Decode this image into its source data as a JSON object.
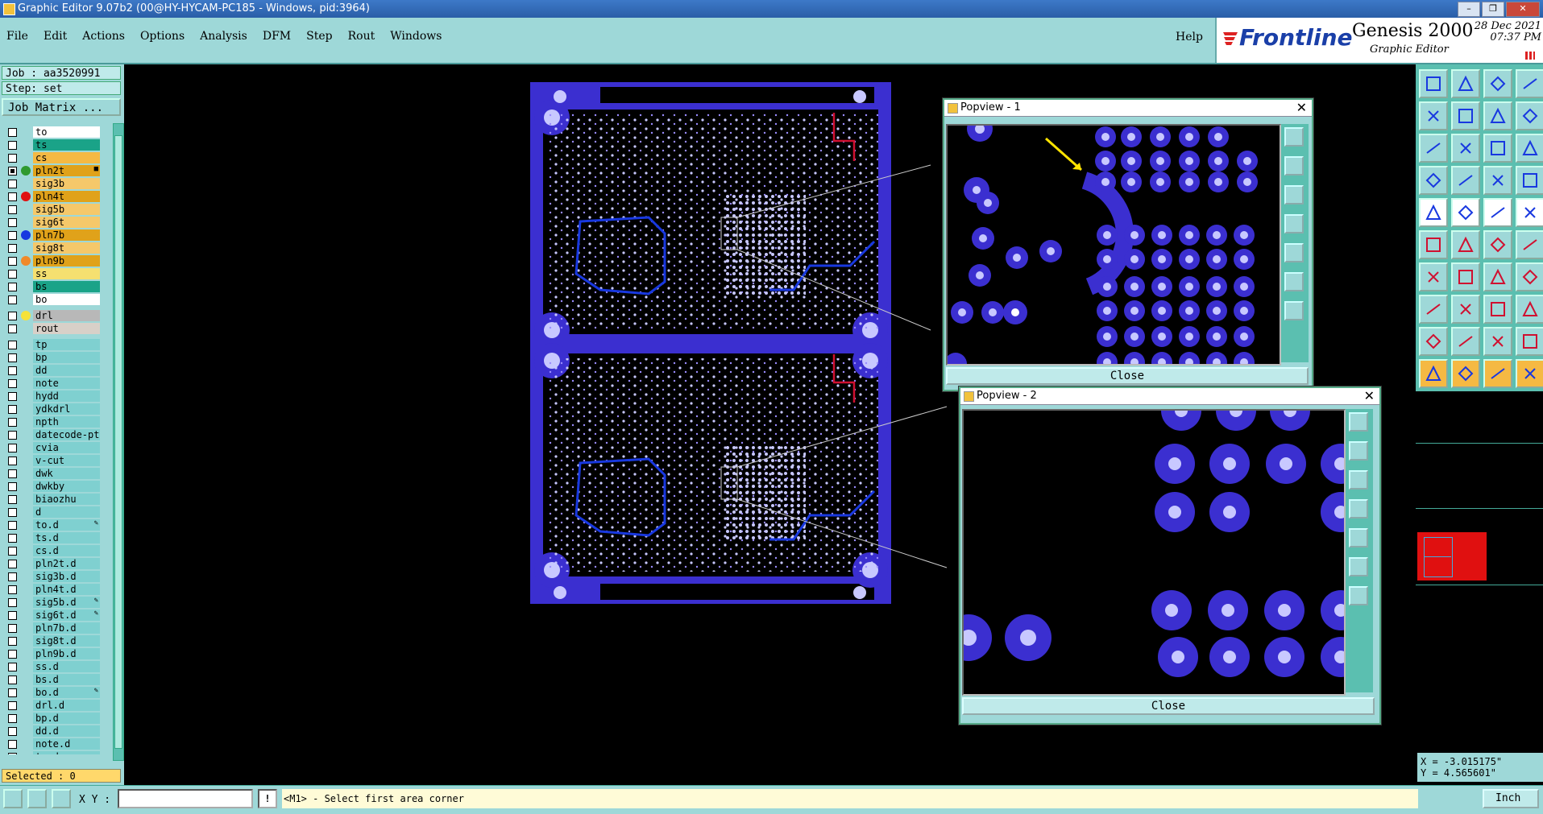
{
  "window": {
    "title": "Graphic Editor 9.07b2 (00@HY-HYCAM-PC185 - Windows, pid:3964)"
  },
  "menu": {
    "items": [
      "File",
      "Edit",
      "Actions",
      "Options",
      "Analysis",
      "DFM",
      "Step",
      "Rout",
      "Windows"
    ],
    "help": "Help"
  },
  "brand": {
    "logo": "Frontline",
    "product": "Genesis 2000",
    "subtitle": "Graphic Editor",
    "date": "28 Dec 2021",
    "time": "07:37 PM"
  },
  "job": {
    "job_label": "Job : aa3520991",
    "step_label": "Step: set",
    "matrix_button": "Job Matrix ..."
  },
  "layers": [
    {
      "name": "to",
      "bg": "#ffffff",
      "dot": "",
      "on": false,
      "sym": ""
    },
    {
      "name": "ts",
      "bg": "#1aa388",
      "dot": "",
      "on": false,
      "sym": ""
    },
    {
      "name": "cs",
      "bg": "#f5b943",
      "dot": "",
      "on": false,
      "sym": ""
    },
    {
      "name": "pln2t",
      "bg": "#e0a21a",
      "dot": "#2f9a2f",
      "on": true,
      "sym": "■"
    },
    {
      "name": "sig3b",
      "bg": "#f5c86a",
      "dot": "",
      "on": false,
      "sym": ""
    },
    {
      "name": "pln4t",
      "bg": "#e0a21a",
      "dot": "#e01010",
      "on": false,
      "sym": ""
    },
    {
      "name": "sig5b",
      "bg": "#f5c86a",
      "dot": "",
      "on": false,
      "sym": ""
    },
    {
      "name": "sig6t",
      "bg": "#f5c86a",
      "dot": "",
      "on": false,
      "sym": ""
    },
    {
      "name": "pln7b",
      "bg": "#e0a21a",
      "dot": "#1838e0",
      "on": false,
      "sym": ""
    },
    {
      "name": "sig8t",
      "bg": "#f5c86a",
      "dot": "",
      "on": false,
      "sym": ""
    },
    {
      "name": "pln9b",
      "bg": "#e0a21a",
      "dot": "#f08a2a",
      "on": false,
      "sym": ""
    },
    {
      "name": "ss",
      "bg": "#f5e070",
      "dot": "",
      "on": false,
      "sym": ""
    },
    {
      "name": "bs",
      "bg": "#1aa388",
      "dot": "",
      "on": false,
      "sym": ""
    },
    {
      "name": "bo",
      "bg": "#ffffff",
      "dot": "",
      "on": false,
      "sym": ""
    },
    {
      "name": "drl",
      "bg": "#b8b8b8",
      "dot": "#f5e23a",
      "on": false,
      "sym": ""
    },
    {
      "name": "rout",
      "bg": "#d8d0c8",
      "dot": "",
      "on": false,
      "sym": ""
    },
    {
      "name": "tp",
      "bg": "#7fd0d0",
      "dot": "",
      "on": false,
      "sym": ""
    },
    {
      "name": "bp",
      "bg": "#7fd0d0",
      "dot": "",
      "on": false,
      "sym": ""
    },
    {
      "name": "dd",
      "bg": "#7fd0d0",
      "dot": "",
      "on": false,
      "sym": ""
    },
    {
      "name": "note",
      "bg": "#7fd0d0",
      "dot": "",
      "on": false,
      "sym": ""
    },
    {
      "name": "hydd",
      "bg": "#7fd0d0",
      "dot": "",
      "on": false,
      "sym": ""
    },
    {
      "name": "ydkdrl",
      "bg": "#7fd0d0",
      "dot": "",
      "on": false,
      "sym": ""
    },
    {
      "name": "npth",
      "bg": "#7fd0d0",
      "dot": "",
      "on": false,
      "sym": ""
    },
    {
      "name": "datecode-pt",
      "bg": "#7fd0d0",
      "dot": "",
      "on": false,
      "sym": ""
    },
    {
      "name": "cvia",
      "bg": "#7fd0d0",
      "dot": "",
      "on": false,
      "sym": ""
    },
    {
      "name": "v-cut",
      "bg": "#7fd0d0",
      "dot": "",
      "on": false,
      "sym": ""
    },
    {
      "name": "dwk",
      "bg": "#7fd0d0",
      "dot": "",
      "on": false,
      "sym": ""
    },
    {
      "name": "dwkby",
      "bg": "#7fd0d0",
      "dot": "",
      "on": false,
      "sym": ""
    },
    {
      "name": "biaozhu",
      "bg": "#7fd0d0",
      "dot": "",
      "on": false,
      "sym": ""
    },
    {
      "name": "d",
      "bg": "#7fd0d0",
      "dot": "",
      "on": false,
      "sym": ""
    },
    {
      "name": "to.d",
      "bg": "#7fd0d0",
      "dot": "",
      "on": false,
      "sym": "✎"
    },
    {
      "name": "ts.d",
      "bg": "#7fd0d0",
      "dot": "",
      "on": false,
      "sym": ""
    },
    {
      "name": "cs.d",
      "bg": "#7fd0d0",
      "dot": "",
      "on": false,
      "sym": ""
    },
    {
      "name": "pln2t.d",
      "bg": "#7fd0d0",
      "dot": "",
      "on": false,
      "sym": ""
    },
    {
      "name": "sig3b.d",
      "bg": "#7fd0d0",
      "dot": "",
      "on": false,
      "sym": ""
    },
    {
      "name": "pln4t.d",
      "bg": "#7fd0d0",
      "dot": "",
      "on": false,
      "sym": ""
    },
    {
      "name": "sig5b.d",
      "bg": "#7fd0d0",
      "dot": "",
      "on": false,
      "sym": "✎"
    },
    {
      "name": "sig6t.d",
      "bg": "#7fd0d0",
      "dot": "",
      "on": false,
      "sym": "✎"
    },
    {
      "name": "pln7b.d",
      "bg": "#7fd0d0",
      "dot": "",
      "on": false,
      "sym": ""
    },
    {
      "name": "sig8t.d",
      "bg": "#7fd0d0",
      "dot": "",
      "on": false,
      "sym": ""
    },
    {
      "name": "pln9b.d",
      "bg": "#7fd0d0",
      "dot": "",
      "on": false,
      "sym": ""
    },
    {
      "name": "ss.d",
      "bg": "#7fd0d0",
      "dot": "",
      "on": false,
      "sym": ""
    },
    {
      "name": "bs.d",
      "bg": "#7fd0d0",
      "dot": "",
      "on": false,
      "sym": ""
    },
    {
      "name": "bo.d",
      "bg": "#7fd0d0",
      "dot": "",
      "on": false,
      "sym": "✎"
    },
    {
      "name": "drl.d",
      "bg": "#7fd0d0",
      "dot": "",
      "on": false,
      "sym": ""
    },
    {
      "name": "bp.d",
      "bg": "#7fd0d0",
      "dot": "",
      "on": false,
      "sym": ""
    },
    {
      "name": "dd.d",
      "bg": "#7fd0d0",
      "dot": "",
      "on": false,
      "sym": ""
    },
    {
      "name": "note.d",
      "bg": "#7fd0d0",
      "dot": "",
      "on": false,
      "sym": ""
    },
    {
      "name": "tp.d",
      "bg": "#7fd0d0",
      "dot": "",
      "on": false,
      "sym": ""
    }
  ],
  "selected": "Selected : 0",
  "popview1": {
    "title": "Popview - 1",
    "close": "Close"
  },
  "popview2": {
    "title": "Popview - 2",
    "close": "Close"
  },
  "coords": {
    "x": "X = -3.015175\"",
    "y": "Y = 4.565601\""
  },
  "status": {
    "xy_label": "X Y :",
    "xy_value": "",
    "message": "<M1> - Select first area corner",
    "units": "Inch"
  },
  "colors": {
    "panel": "#9ed8d8",
    "copper": "#3b2fd0",
    "trace_red": "#d01030"
  }
}
